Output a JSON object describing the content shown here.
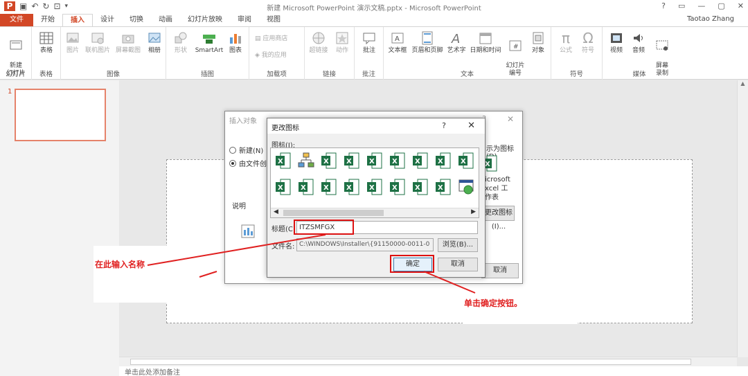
{
  "window": {
    "title": "新建 Microsoft PowerPoint 演示文稿.pptx - Microsoft PowerPoint",
    "controls": [
      "?",
      "▭",
      "—",
      "▢",
      "✕"
    ]
  },
  "tabs": [
    {
      "label": "文件",
      "type": "file"
    },
    {
      "label": "开始"
    },
    {
      "label": "插入",
      "active": true
    },
    {
      "label": "设计"
    },
    {
      "label": "切换"
    },
    {
      "label": "动画"
    },
    {
      "label": "幻灯片放映"
    },
    {
      "label": "审阅"
    },
    {
      "label": "视图"
    }
  ],
  "user": "Taotao Zhang",
  "ribbon": {
    "new_slide": "新建\n幻灯片",
    "table": "表格",
    "picture": "图片",
    "online_picture": "联机图片",
    "screenshot": "屏幕截图",
    "album": "相册",
    "shapes": "形状",
    "smartart": "SmartArt",
    "chart": "图表",
    "store": "应用商店",
    "my_apps": "我的应用",
    "hyperlink": "超链接",
    "action": "动作",
    "comment": "批注",
    "textbox": "文本框",
    "header_footer": "页眉和页脚",
    "wordart": "艺术字",
    "datetime": "日期和时间",
    "slide_number": "幻灯片\n编号",
    "object": "对象",
    "equation": "公式",
    "symbol": "符号",
    "video": "视频",
    "audio": "音频",
    "screen_record": "屏幕\n录制",
    "groups": {
      "slides": "幻灯片",
      "tables": "表格",
      "images": "图像",
      "illustrations": "插图",
      "addins": "加载项",
      "links": "链接",
      "comments": "批注",
      "text": "文本",
      "symbols": "符号",
      "media": "媒体"
    }
  },
  "slide_pane": {
    "number": "1"
  },
  "notes_placeholder": "单击此处添加备注",
  "insert_object_dialog": {
    "title": "插入对象",
    "help": "?",
    "close": "✕",
    "option_new": "新建(N)",
    "option_from_file": "由文件创",
    "display_as_icon": "示为图标(D)",
    "icon_caption": "icrosoft\nxcel 工\n作表",
    "change_icon": "更改图标(I)...",
    "description": "说明",
    "cancel": "取消"
  },
  "change_icon_dialog": {
    "title": "更改图标",
    "help": "?",
    "close": "✕",
    "icons_label": "图标(I):",
    "caption_label": "标题(C)",
    "caption_value": "ITZSMFGX",
    "file_label": "文件名:",
    "file_value": "C:\\WINDOWS\\Installer\\{91150000-0011-0",
    "browse": "浏览(B)...",
    "ok": "确定",
    "cancel": "取消"
  },
  "annotations": {
    "input_name": "在此输入名称",
    "click_ok": "单击确定按钮。"
  },
  "colors": {
    "accent": "#d24726",
    "annotation": "#e02020",
    "excel_green": "#1e7145"
  }
}
